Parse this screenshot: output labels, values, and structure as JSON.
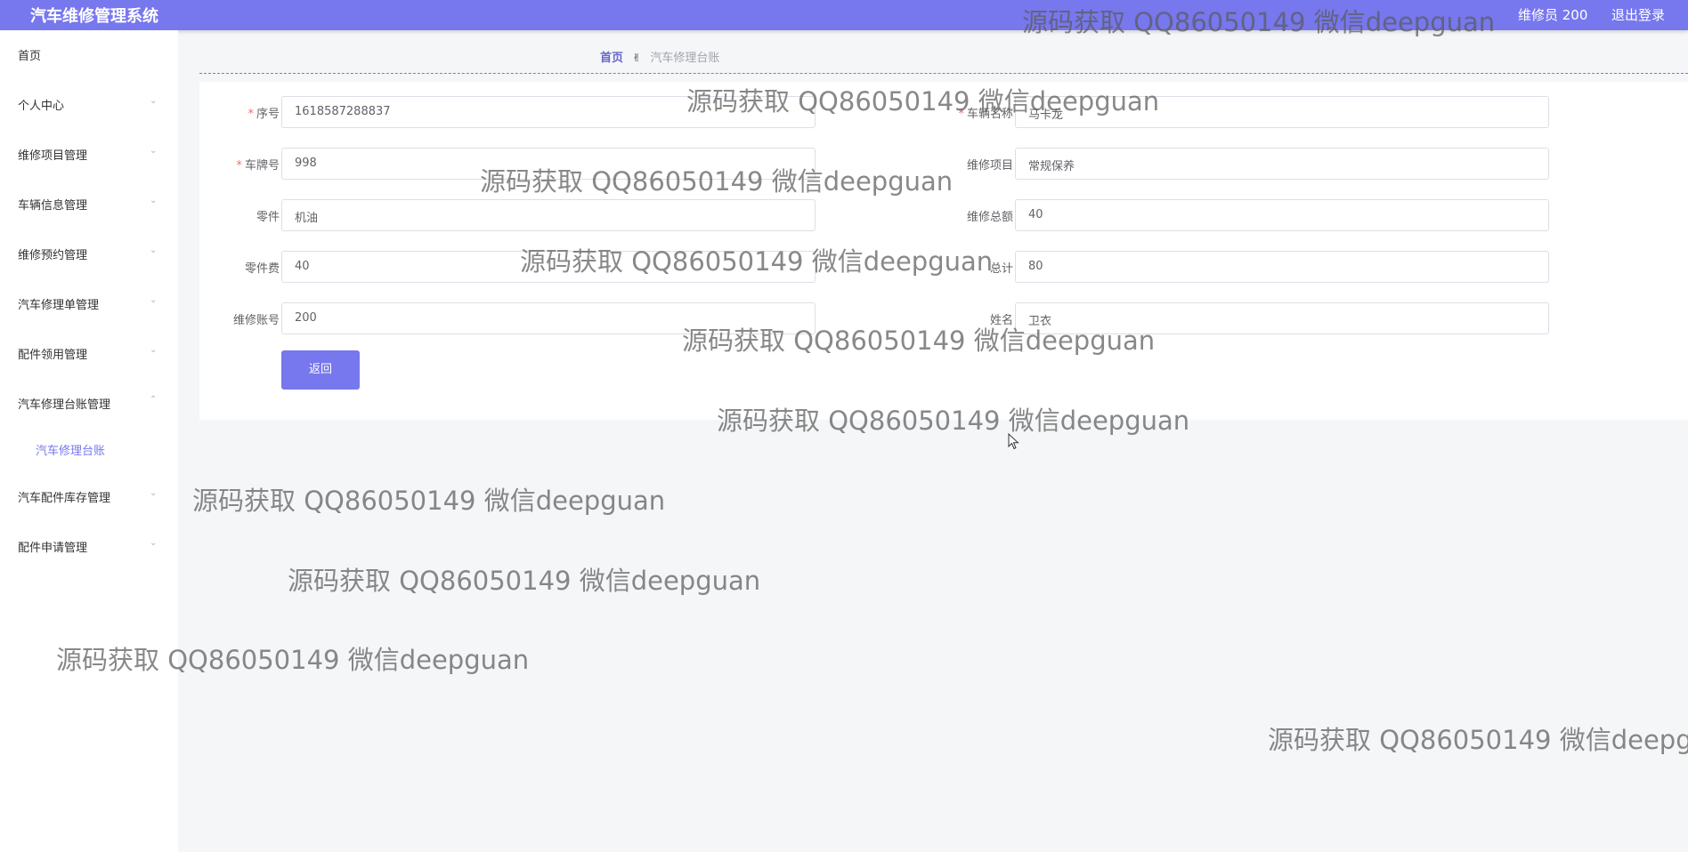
{
  "header": {
    "app_title": "汽车维修管理系统",
    "user_label": "维修员 200",
    "logout_label": "退出登录"
  },
  "sidebar": {
    "items": [
      {
        "label": "首页",
        "arrow": ""
      },
      {
        "label": "个人中心",
        "arrow": "⌄"
      },
      {
        "label": "维修项目管理",
        "arrow": "⌄"
      },
      {
        "label": "车辆信息管理",
        "arrow": "⌄"
      },
      {
        "label": "维修预约管理",
        "arrow": "⌄"
      },
      {
        "label": "汽车修理单管理",
        "arrow": "⌄"
      },
      {
        "label": "配件领用管理",
        "arrow": "⌄"
      },
      {
        "label": "汽车修理台账管理",
        "arrow": "⌃"
      },
      {
        "label": "汽车修理台账",
        "arrow": ""
      },
      {
        "label": "汽车配件库存管理",
        "arrow": "⌄"
      },
      {
        "label": "配件申请管理",
        "arrow": "⌄"
      }
    ]
  },
  "breadcrumb": {
    "home": "首页",
    "icon": "✌",
    "current": "汽车修理台账"
  },
  "form": {
    "fields": [
      {
        "label": "序号",
        "value": "1618587288837",
        "required": "*"
      },
      {
        "label": "车辆名称",
        "value": "马卡龙",
        "required": "*"
      },
      {
        "label": "车牌号",
        "value": "998",
        "required": "*"
      },
      {
        "label": "维修项目",
        "value": "常规保养",
        "required": ""
      },
      {
        "label": "零件",
        "value": "机油",
        "required": ""
      },
      {
        "label": "维修总额",
        "value": "40",
        "required": ""
      },
      {
        "label": "零件费",
        "value": "40",
        "required": ""
      },
      {
        "label": "总计",
        "value": "80",
        "required": ""
      },
      {
        "label": "维修账号",
        "value": "200",
        "required": ""
      },
      {
        "label": "姓名",
        "value": "卫衣",
        "required": ""
      }
    ],
    "back_label": "返回"
  },
  "watermark": {
    "text": "源码获取 QQ86050149 微信deepguan"
  },
  "colors": {
    "accent": "#7777ee",
    "background": "#f5f6f8",
    "required": "#f56c6c"
  }
}
